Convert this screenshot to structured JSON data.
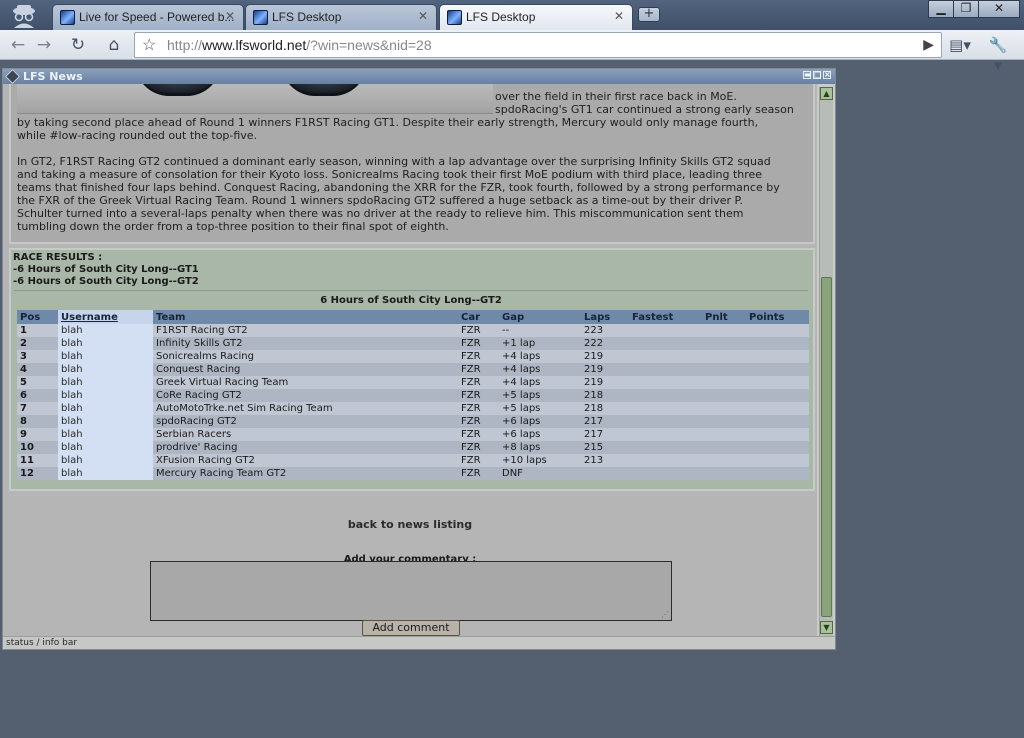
{
  "browser": {
    "tabs": [
      {
        "label": "Live for Speed - Powered b...",
        "active": false
      },
      {
        "label": "LFS Desktop",
        "active": false
      },
      {
        "label": "LFS Desktop",
        "active": true
      }
    ],
    "new_tab": "+",
    "window_controls": {
      "minimize": "▁",
      "maximize": "❐",
      "close": "✕"
    },
    "url": {
      "scheme": "http://",
      "host": "www.lfsworld.net",
      "path": "/?win=news&nid=28"
    }
  },
  "lfs_window": {
    "title": "LFS News",
    "controls": {
      "minimize": "▬",
      "maximize": "□",
      "close": "×"
    }
  },
  "story": {
    "lines": [
      "over the field in their first race back in MoE.",
      "spdoRacing's GT1 car continued a strong early season",
      "by taking second place ahead of Round 1 winners F1RST Racing GT1. Despite their early strength, Mercury would only manage fourth,",
      "while #low-racing rounded out the top-five.",
      "In GT2, F1RST Racing GT2 continued a dominant early season, winning with a lap advantage over the surprising Infinity Skills GT2 squad",
      "and taking a measure of consolation for their Kyoto loss. Sonicrealms Racing took their first MoE podium with third place, leading three",
      "teams that finished four laps behind. Conquest Racing, abandoning the XRR for the FZR, took fourth, followed by a strong performance by",
      "the FXR of the Greek Virtual Racing Team. Round 1 winners spdoRacing GT2 suffered a huge setback as a time-out by their driver P.",
      "Schulter turned into a several-laps penalty when there was no driver at the ready to relieve him. This miscommunication sent them",
      "tumbling down the order from a top-three position to their final spot of eighth."
    ]
  },
  "results": {
    "heading": "RACE RESULTS :",
    "links": [
      "-6 Hours of South City Long--GT1",
      "-6 Hours of South City Long--GT2"
    ],
    "table_title": "6 Hours of South City Long--GT2",
    "columns": [
      "Pos",
      "Username",
      "Team",
      "Car",
      "Gap",
      "Laps",
      "Fastest",
      "Pnlt",
      "Points"
    ],
    "rows": [
      {
        "pos": "1",
        "user": "blah",
        "team": "F1RST Racing GT2",
        "car": "FZR",
        "gap": "--",
        "laps": "223"
      },
      {
        "pos": "2",
        "user": "blah",
        "team": "Infinity Skills GT2",
        "car": "FZR",
        "gap": "+1 lap",
        "laps": "222"
      },
      {
        "pos": "3",
        "user": "blah",
        "team": "Sonicrealms Racing",
        "car": "FZR",
        "gap": "+4 laps",
        "laps": "219"
      },
      {
        "pos": "4",
        "user": "blah",
        "team": "Conquest Racing",
        "car": "FZR",
        "gap": "+4 laps",
        "laps": "219"
      },
      {
        "pos": "5",
        "user": "blah",
        "team": "Greek Virtual Racing Team",
        "car": "FZR",
        "gap": "+4 laps",
        "laps": "219"
      },
      {
        "pos": "6",
        "user": "blah",
        "team": "CoRe Racing GT2",
        "car": "FZR",
        "gap": "+5 laps",
        "laps": "218"
      },
      {
        "pos": "7",
        "user": "blah",
        "team": "AutoMotoTrke.net Sim Racing Team",
        "car": "FZR",
        "gap": "+5 laps",
        "laps": "218"
      },
      {
        "pos": "8",
        "user": "blah",
        "team": "spdoRacing GT2",
        "car": "FZR",
        "gap": "+6 laps",
        "laps": "217"
      },
      {
        "pos": "9",
        "user": "blah",
        "team": "Serbian Racers",
        "car": "FZR",
        "gap": "+6 laps",
        "laps": "217"
      },
      {
        "pos": "10",
        "user": "blah",
        "team": "prodrive' Racing",
        "car": "FZR",
        "gap": "+8 laps",
        "laps": "215"
      },
      {
        "pos": "11",
        "user": "blah",
        "team": "XFusion Racing GT2",
        "car": "FZR",
        "gap": "+10 laps",
        "laps": "213"
      },
      {
        "pos": "12",
        "user": "blah",
        "team": "Mercury Racing Team GT2",
        "car": "FZR",
        "gap": "DNF",
        "laps": ""
      }
    ]
  },
  "back_link": "back to news listing",
  "comment": {
    "label": "Add your commentary :",
    "value": "",
    "button": "Add comment"
  },
  "status_bar": "status / info bar"
}
